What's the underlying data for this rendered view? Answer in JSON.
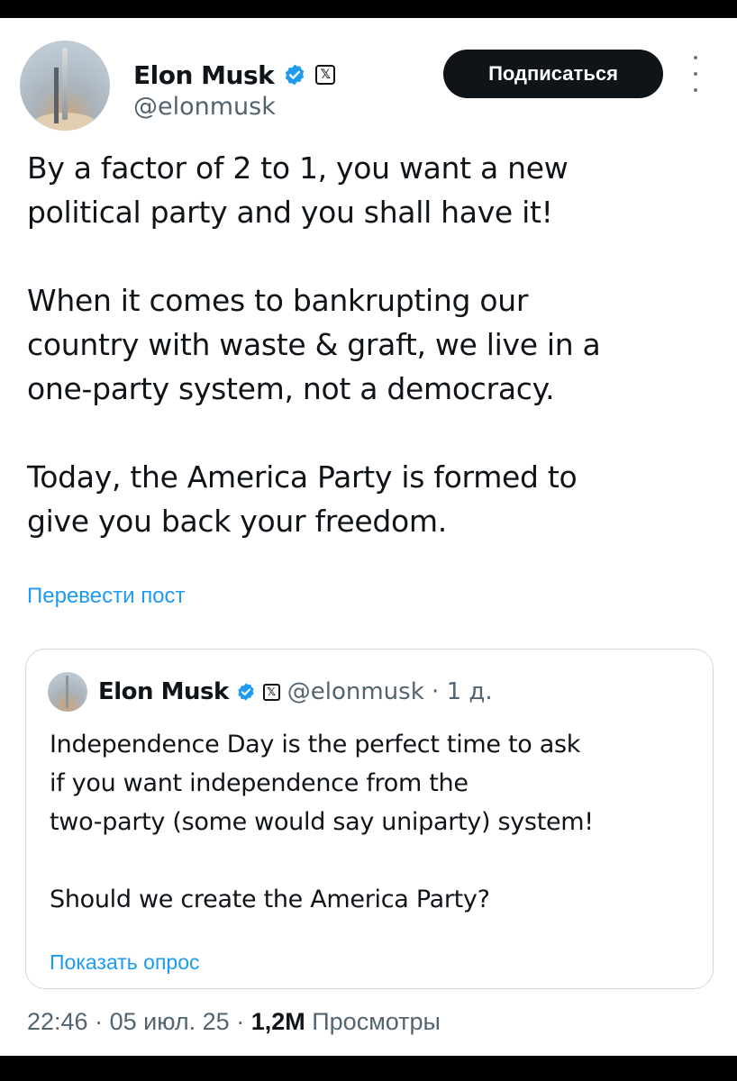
{
  "author": {
    "name": "Elon Musk",
    "handle": "@elonmusk",
    "verified_color": "#1d9bf0",
    "x_badge_glyph": "𝕏"
  },
  "actions": {
    "subscribe_label": "Подписаться",
    "more_icon": "more-vertical-icon"
  },
  "tweet": {
    "paragraphs": [
      "By a factor of 2 to 1, you want a new\npolitical party and you shall have it!",
      "When it comes to bankrupting our\ncountry with waste & graft, we live in a\none-party system, not a democracy.",
      "Today, the America Party is formed to\ngive you back your freedom."
    ],
    "translate_label": "Перевести пост"
  },
  "quote": {
    "name": "Elon Musk",
    "handle": "@elonmusk",
    "time": "1 д.",
    "separator": "·",
    "paragraphs": [
      "Independence Day is the perfect time to ask\nif you want independence from the\ntwo-party (some would say uniparty) system!",
      "Should we create the America Party?"
    ],
    "poll_label": "Показать опрос"
  },
  "meta": {
    "time": "22:46",
    "date": "05 июл. 25",
    "separator": "·",
    "views_count": "1,2M",
    "views_label": "Просмотры"
  },
  "colors": {
    "link": "#1d9bf0",
    "text": "#0f1419",
    "secondary": "#536471",
    "button_bg": "#0f1419"
  }
}
